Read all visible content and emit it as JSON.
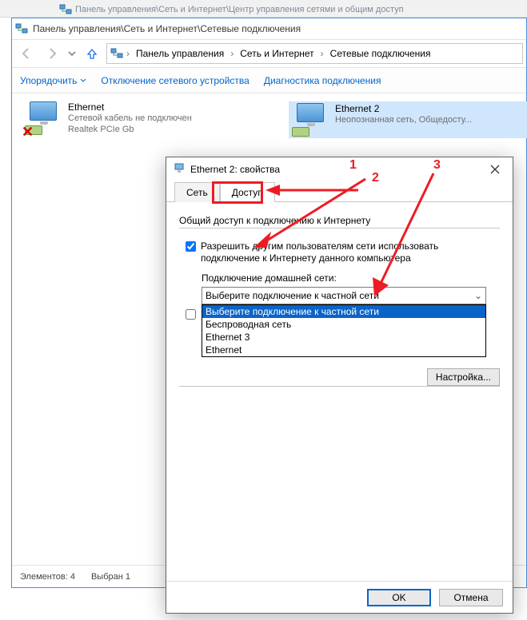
{
  "faded_path": "Панель управления\\Сеть и Интернет\\Центр управления сетями и общим доступ",
  "window_title": "Панель управления\\Сеть и Интернет\\Сетевые подключения",
  "breadcrumbs": [
    "Панель управления",
    "Сеть и Интернет",
    "Сетевые подключения"
  ],
  "toolbar": {
    "organize": "Упорядочить",
    "disable": "Отключение сетевого устройства",
    "diagnose": "Диагностика подключения"
  },
  "connections": {
    "eth1": {
      "name": "Ethernet",
      "status": "Сетевой кабель не подключен",
      "device": "Realtek PCIe Gb"
    },
    "eth2": {
      "name": "Ethernet 2",
      "status": "Неопознанная сеть, Общедосту..."
    }
  },
  "statusbar": {
    "count": "Элементов: 4",
    "selected": "Выбран 1"
  },
  "dialog": {
    "title": "Ethernet 2: свойства",
    "tabs": {
      "network": "Сеть",
      "access": "Доступ"
    },
    "group": "Общий доступ к подключению к Интернету",
    "check1": "Разрешить другим пользователям сети использовать подключение к Интернету данного компьютера",
    "home_label": "Подключение домашней сети:",
    "combo_value": "Выберите подключение к частной сети",
    "options": [
      "Выберите подключение к частной сети",
      "Беспроводная сеть",
      "Ethernet 3",
      "Ethernet"
    ],
    "settings_btn": "Настройка...",
    "ok": "OK",
    "cancel": "Отмена"
  },
  "annotations": {
    "n1": "1",
    "n2": "2",
    "n3": "3"
  }
}
